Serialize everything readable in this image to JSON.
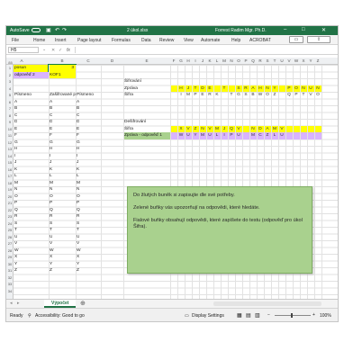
{
  "titlebar": {
    "autosave": "AutoSave",
    "filename": "2 úkol.xlsx",
    "user": "Forrest Radim Mgr. Ph.D."
  },
  "ribbon": {
    "tabs": [
      "File",
      "Home",
      "Insert",
      "Page layout",
      "Formulas",
      "Data",
      "Review",
      "View",
      "Automate",
      "Help",
      "ACROBAT"
    ]
  },
  "formula_bar": {
    "namebox": "H5",
    "fx": "fx"
  },
  "columns": [
    "A",
    "B",
    "C",
    "D",
    "E",
    "F",
    "G",
    "H",
    "I",
    "J",
    "K",
    "L",
    "M",
    "N",
    "O",
    "P",
    "Q",
    "R",
    "S",
    "T",
    "U",
    "V",
    "W",
    "X",
    "Y",
    "Z"
  ],
  "rows": [
    "1",
    "2",
    "3",
    "4",
    "5",
    "6",
    "7",
    "8",
    "9",
    "10",
    "11",
    "12",
    "13",
    "14",
    "15",
    "16",
    "17",
    "18",
    "19",
    "20",
    "21",
    "22",
    "23",
    "24",
    "25",
    "26",
    "27",
    "28",
    "29",
    "30",
    "31",
    "32",
    "33",
    "34"
  ],
  "sheet": {
    "a1": "posun",
    "b1": "3",
    "a2": "odpověď 2",
    "b2": "KOF1",
    "head_a": "Písmeno",
    "head_b": "Zašifrované písmeno",
    "head_c": "Písmeno",
    "letters": [
      "A",
      "B",
      "C",
      "D",
      "E",
      "F",
      "G",
      "H",
      "I",
      "J",
      "K",
      "L",
      "M",
      "N",
      "O",
      "P",
      "Q",
      "R",
      "S",
      "T",
      "U",
      "V",
      "W",
      "X",
      "Y",
      "Z"
    ],
    "enc": [
      "A",
      "B",
      "C",
      "D",
      "E",
      "F",
      "G",
      "H",
      "I",
      "J",
      "K",
      "L",
      "M",
      "N",
      "O",
      "P",
      "Q",
      "R",
      "S",
      "T",
      "U",
      "V",
      "W",
      "X",
      "Y",
      "Z"
    ],
    "sifrovani": "Šifrování",
    "zprava": "Zpráva",
    "sifra": "Šifra",
    "desifrovani": "Dešifrování",
    "sifra2": "Šifra",
    "zprava2": "Zpráva - odpověď 1",
    "row3_letters": [
      "H",
      "J",
      "T",
      "D",
      "E",
      "",
      "T",
      "",
      "S",
      "R",
      "A",
      "H",
      "N",
      "Y",
      "",
      "P",
      "O",
      "N",
      "U",
      "N"
    ],
    "row4_letters": [
      "I",
      "M",
      "P",
      "E",
      "R",
      "K",
      "",
      "T",
      "G",
      "S",
      "B",
      "W",
      "O",
      "Z",
      "",
      "Q",
      "P",
      "T",
      "V",
      "O"
    ],
    "row7_letters": [
      "X",
      "V",
      "Z",
      "N",
      "V",
      "M",
      "J",
      "Q",
      "V",
      "",
      "N",
      "D",
      "A",
      "M",
      "V"
    ],
    "row8_letters": [
      "W",
      "U",
      "Y",
      "M",
      "U",
      "L",
      "I",
      "P",
      "U",
      "",
      "M",
      "C",
      "Z",
      "L",
      "U"
    ]
  },
  "note": {
    "line1": "Do žlutých buněk si zapisujte dle své potřeby.",
    "line2": "Zelené buňky vás upozorňují na odpovědi, které hledáte.",
    "line3": "Fialové buňky obsahují odpovědi, které zapíšete do testu (odpověď pro úkol Šifra)."
  },
  "sheet_tab": "Výpočet",
  "status": {
    "ready": "Ready",
    "accessibility": "Accessibility: Good to go",
    "display": "Display Settings",
    "zoom": "100%"
  },
  "colors": {
    "excel_green": "#217346",
    "yellow": "#ffff00",
    "purple": "#d9b3ff",
    "note_green": "#a9d18e"
  }
}
